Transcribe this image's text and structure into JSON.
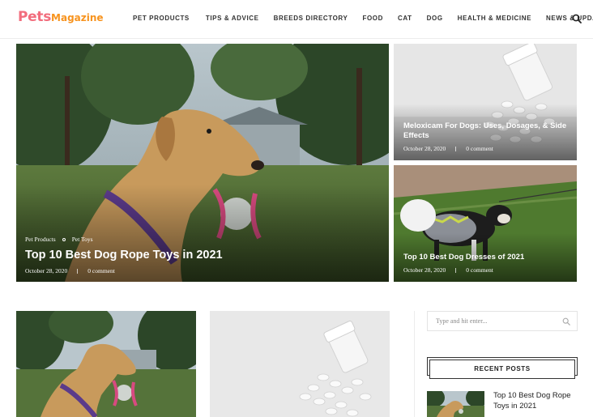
{
  "logo": {
    "part1": "Pets",
    "part2": "Magazine"
  },
  "nav": {
    "items": [
      "PET PRODUCTS",
      "TIPS & ADVICE",
      "BREEDS DIRECTORY",
      "FOOD",
      "CAT",
      "DOG",
      "HEALTH & MEDICINE",
      "NEWS & UPDATES"
    ],
    "search_icon": "search-icon"
  },
  "hero": {
    "main": {
      "categories": [
        "Pet Products",
        "Pet Toys"
      ],
      "title": "Top 10 Best Dog Rope Toys in 2021",
      "date": "October 28, 2020",
      "comments": "0 comment"
    },
    "top_right": {
      "title": "Meloxicam For Dogs: Uses, Dosages, & Side Effects",
      "date": "October 28, 2020",
      "comments": "0 comment"
    },
    "bottom_right": {
      "title": "Top 10 Best Dog Dresses of 2021",
      "date": "October 28, 2020",
      "comments": "0 comment"
    }
  },
  "sidebar": {
    "search_placeholder": "Type and hit enter...",
    "recent_posts_heading": "RECENT POSTS",
    "recent_posts": [
      {
        "title": "Top 10 Best Dog Rope Toys in 2021"
      }
    ]
  },
  "colors": {
    "logo_pink": "#f26d7d",
    "logo_orange": "#f7931e",
    "text_dark": "#222222"
  }
}
